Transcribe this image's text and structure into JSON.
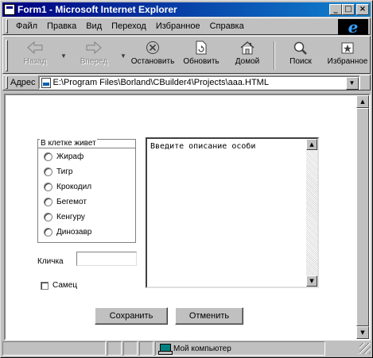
{
  "window": {
    "title": "Form1 - Microsoft Internet Explorer",
    "min_glyph": "_",
    "max_glyph": "□",
    "close_glyph": "×"
  },
  "menu": {
    "items": [
      {
        "label": "Файл"
      },
      {
        "label": "Правка"
      },
      {
        "label": "Вид"
      },
      {
        "label": "Переход"
      },
      {
        "label": "Избранное"
      },
      {
        "label": "Справка"
      }
    ],
    "logo_glyph": "e"
  },
  "toolbar": {
    "back": {
      "label": "Назад",
      "icon": "back-arrow-icon",
      "enabled": false
    },
    "forward": {
      "label": "Вперед",
      "icon": "forward-arrow-icon",
      "enabled": false
    },
    "stop": {
      "label": "Остановить",
      "icon": "stop-icon"
    },
    "refresh": {
      "label": "Обновить",
      "icon": "refresh-icon"
    },
    "home": {
      "label": "Домой",
      "icon": "home-icon"
    },
    "search": {
      "label": "Поиск",
      "icon": "search-icon"
    },
    "favorites": {
      "label": "Избранное",
      "icon": "favorites-icon"
    },
    "drop_glyph": "▼"
  },
  "address": {
    "label": "Адрес",
    "value": "E:\\Program Files\\Borland\\CBuilder4\\Projects\\aaa.HTML"
  },
  "form": {
    "group_caption": "В клетке живет",
    "animals": [
      "Жираф",
      "Тигр",
      "Крокодил",
      "Бегемот",
      "Кенгуру",
      "Динозавр"
    ],
    "name_label": "Кличка",
    "name_value": "",
    "male_label": "Самец",
    "description": "Введите описание особи",
    "save_label": "Сохранить",
    "cancel_label": "Отменить"
  },
  "scroll": {
    "up_glyph": "▲",
    "down_glyph": "▼"
  },
  "status": {
    "zone_text": "Мой компьютер"
  }
}
